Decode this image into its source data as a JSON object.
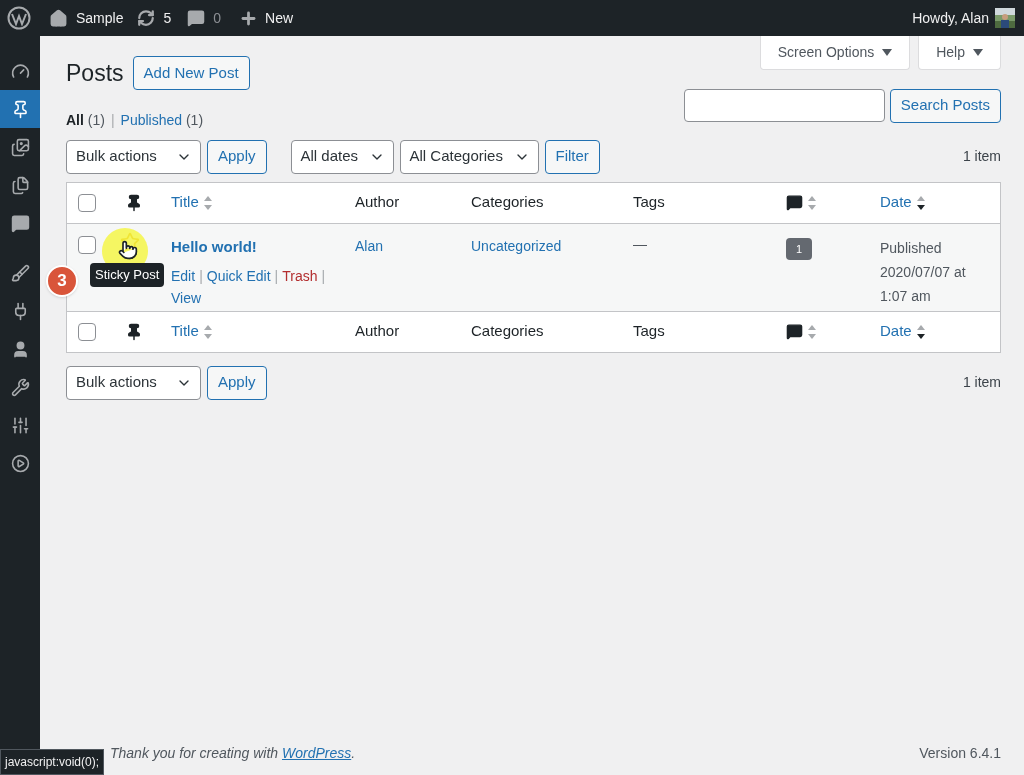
{
  "top_bar": {
    "site": "Sample",
    "updates": "5",
    "comments": "0",
    "new": "New",
    "greeting": "Howdy, Alan"
  },
  "sidebar": {
    "items": [
      {
        "selected": false
      },
      {
        "selected": true
      },
      {
        "selected": false
      },
      {
        "selected": false
      },
      {
        "selected": false
      },
      {
        "selected": false
      },
      {
        "selected": false
      },
      {
        "selected": false
      },
      {
        "selected": false
      },
      {
        "selected": false
      },
      {
        "selected": false
      }
    ]
  },
  "screen_tabs": [
    {
      "label": "Screen Options",
      "expanded": false
    },
    {
      "label": "Help",
      "expanded": false
    }
  ],
  "page_title": "Posts",
  "add_button": "Add New Post",
  "filters": [
    {
      "label": "All",
      "count": "(1)",
      "selected": true,
      "separator": "|"
    },
    {
      "label": "Published",
      "count": "(1)",
      "selected": false
    }
  ],
  "search": {
    "button": "Search Posts"
  },
  "top_actions": {
    "bulk": "Bulk actions",
    "apply": "Apply",
    "dates": "All dates",
    "categories": "All Categories",
    "filter": "Filter",
    "count": "1 item"
  },
  "table": {
    "header": [
      {
        "kind": "checkbox",
        "checked": false
      },
      {
        "kind": "pin"
      },
      {
        "kind": "link",
        "label": "Title",
        "sorted": false
      },
      {
        "kind": "text",
        "label": "Author"
      },
      {
        "kind": "text",
        "label": "Categories"
      },
      {
        "kind": "text",
        "label": "Tags"
      },
      {
        "kind": "comments",
        "sorted": false
      },
      {
        "kind": "link",
        "label": "Date",
        "sorted": true
      }
    ],
    "rows": [
      {
        "checked": false,
        "sticky": false,
        "title": "Hello world!",
        "actions": [
          {
            "label": "Edit",
            "kind": "link",
            "separator": "|"
          },
          {
            "label": "Quick Edit",
            "kind": "link",
            "separator": "|"
          },
          {
            "label": "Trash",
            "kind": "danger",
            "separator": "|"
          },
          {
            "label": "View",
            "kind": "link"
          }
        ],
        "author": "Alan",
        "category": "Uncategorized",
        "tags": "—",
        "comments": "1",
        "status": "Published",
        "date": "2020/07/07 at 1:07 am"
      }
    ],
    "footer": [
      {
        "kind": "checkbox",
        "checked": false
      },
      {
        "kind": "pin"
      },
      {
        "kind": "link",
        "label": "Title",
        "sorted": false
      },
      {
        "kind": "text",
        "label": "Author"
      },
      {
        "kind": "text",
        "label": "Categories"
      },
      {
        "kind": "text",
        "label": "Tags"
      },
      {
        "kind": "comments",
        "sorted": false
      },
      {
        "kind": "link",
        "label": "Date",
        "sorted": true
      }
    ]
  },
  "tooltip": "Sticky Post",
  "step_badge": "3",
  "bottom_actions": {
    "bulk": "Bulk actions",
    "apply": "Apply",
    "count": "1 item"
  },
  "page_footer": {
    "text": "Thank you for creating with ",
    "link": "WordPress",
    "end": ".",
    "version": "Version 6.4.1"
  },
  "status_url": "javascript:void(0);"
}
